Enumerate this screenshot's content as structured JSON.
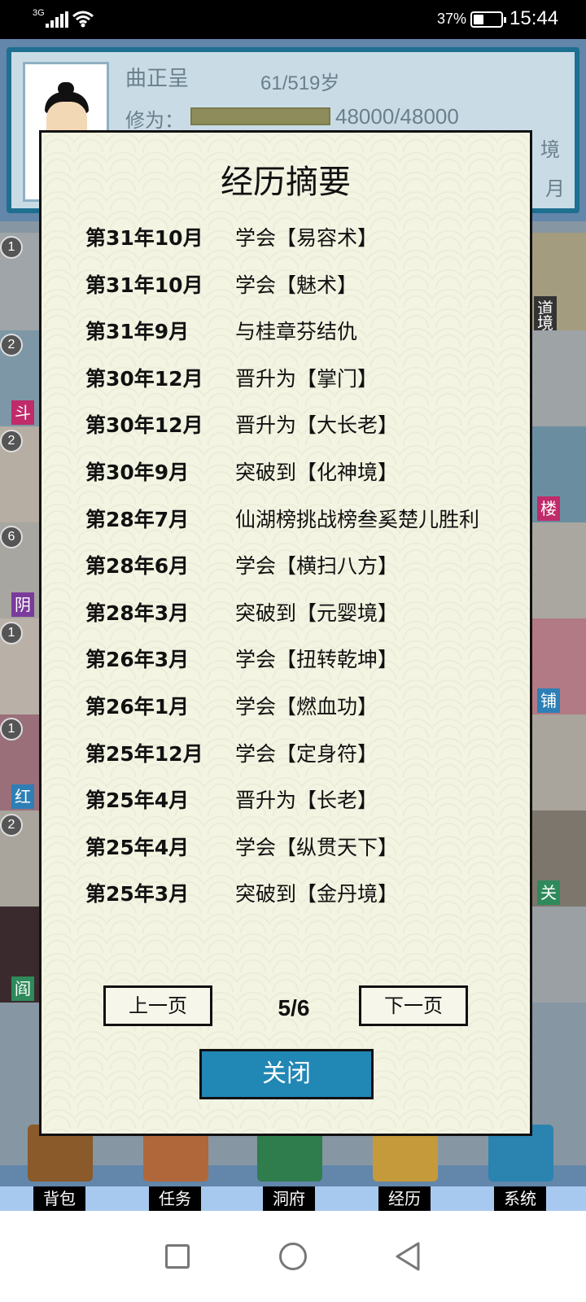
{
  "status_bar": {
    "network": "3G",
    "battery_pct_text": "37%",
    "battery_level": 0.37,
    "time": "15:44"
  },
  "profile": {
    "name": "曲正呈",
    "age": "61/519岁",
    "cultivation_label": "修为：",
    "cultivation_value": "48000/48000",
    "cultivation_fill": 1.0,
    "right_fragment_1": "境",
    "right_fragment_2": "月"
  },
  "map_tiles": [
    {
      "badge": "1",
      "tag": ""
    },
    {
      "badge": "2",
      "tag": "斗"
    },
    {
      "badge": "2",
      "tag": ""
    },
    {
      "badge": "6",
      "tag": "阴"
    },
    {
      "badge": "1",
      "tag": ""
    },
    {
      "badge": "1",
      "tag": "红"
    },
    {
      "badge": "2",
      "tag": ""
    },
    {
      "badge": "",
      "tag": "阎"
    }
  ],
  "right_tags": [
    "道",
    "境",
    "楼",
    "铺",
    "关"
  ],
  "dialog": {
    "title": "经历摘要",
    "entries": [
      {
        "date": "第31年10月",
        "event": "学会【易容术】"
      },
      {
        "date": "第31年10月",
        "event": "学会【魅术】"
      },
      {
        "date": "第31年9月",
        "event": "与桂章芬结仇"
      },
      {
        "date": "第30年12月",
        "event": "晋升为【掌门】"
      },
      {
        "date": "第30年12月",
        "event": "晋升为【大长老】"
      },
      {
        "date": "第30年9月",
        "event": "突破到【化神境】"
      },
      {
        "date": "第28年7月",
        "event": "仙湖榜挑战榜叁奚楚儿胜利"
      },
      {
        "date": "第28年6月",
        "event": "学会【横扫八方】"
      },
      {
        "date": "第28年3月",
        "event": "突破到【元婴境】"
      },
      {
        "date": "第26年3月",
        "event": "学会【扭转乾坤】"
      },
      {
        "date": "第26年1月",
        "event": "学会【燃血功】"
      },
      {
        "date": "第25年12月",
        "event": "学会【定身符】"
      },
      {
        "date": "第25年4月",
        "event": "晋升为【长老】"
      },
      {
        "date": "第25年4月",
        "event": "学会【纵贯天下】"
      },
      {
        "date": "第25年3月",
        "event": "突破到【金丹境】"
      }
    ],
    "prev_label": "上一页",
    "next_label": "下一页",
    "page_indicator": "5/6",
    "close_label": "关闭"
  },
  "bottom_nav": [
    {
      "label": "背包",
      "icon": "backpack-icon",
      "color": "#8a5a2b"
    },
    {
      "label": "任务",
      "icon": "quest-board-icon",
      "color": "#b0683a"
    },
    {
      "label": "洞府",
      "icon": "cave-house-icon",
      "color": "#2f7d4d"
    },
    {
      "label": "经历",
      "icon": "history-scroll-icon",
      "color": "#c49a3b"
    },
    {
      "label": "系统",
      "icon": "system-gear-icon",
      "color": "#2b83b0"
    }
  ],
  "colors": {
    "dialog_bg": "#f3f4e2",
    "close_button": "#2187b5",
    "panel_border": "#1e6f90"
  }
}
